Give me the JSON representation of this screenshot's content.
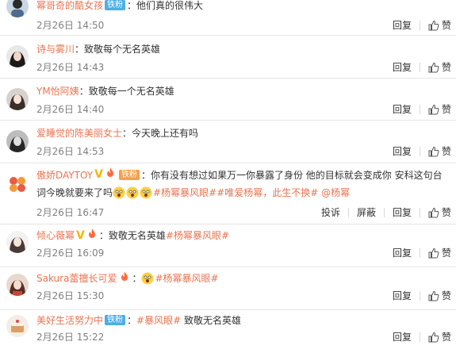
{
  "labels": {
    "reply": "回复",
    "like": "赞",
    "report": "投诉",
    "block": "屏蔽"
  },
  "colors": {
    "username": "#eb7350",
    "link": "#eb7350",
    "fan_badge": "#4aaee8",
    "verified": "#f7b500",
    "time": "#808080"
  },
  "comments": [
    {
      "username": "幂哥奇的酷女孩",
      "fan_badge": "铁粉",
      "content": "他们真的很伟大",
      "time": "2月26日 14:50",
      "avatar_icon": "avatar-boy-icon"
    },
    {
      "username": "诗与雾川",
      "content": "致敬每个无名英雄",
      "time": "2月26日 14:43",
      "avatar_icon": "avatar-girl-dark-icon"
    },
    {
      "username": "YM怡阿姨",
      "content": "致敬每一个无名英雄",
      "time": "2月26日 14:40",
      "avatar_icon": "avatar-girl-light-icon"
    },
    {
      "username": "爱睡觉的陈美丽女士",
      "content": "今天晚上还有吗",
      "time": "2月26日 14:53",
      "avatar_icon": "avatar-girl-bw-icon"
    },
    {
      "username": "傲娇DAYTOY",
      "fan_badge": "铁粉",
      "content_a": "你有没有想过如果万一你暴露了身份 他的目标就会变成你 安科这句台词今晚就要来了吗",
      "emoji_icons": [
        "fear-emoji",
        "fear-emoji",
        "fear-emoji"
      ],
      "tags": [
        "#杨幂暴风眼#",
        "#唯爱杨幂，此生不换#",
        "@杨幂"
      ],
      "time": "2月26日 16:47",
      "avatar_icon": "avatar-logo-icon"
    },
    {
      "username": "倾心薇幂",
      "content": "致敬无名英雄",
      "tags": [
        "#杨幂暴风眼#"
      ],
      "time": "2月26日 16:09",
      "avatar_icon": "avatar-girl-white-icon"
    },
    {
      "username": "Sakura蕾擅长可爱",
      "emoji_icons": [
        "fear-emoji"
      ],
      "tags": [
        "#杨幂暴风眼#"
      ],
      "time": "2月26日 15:30",
      "avatar_icon": "avatar-girl-red-icon"
    },
    {
      "username": "美好生活努力中",
      "fan_badge": "铁粉",
      "tags": [
        "#暴风眼#"
      ],
      "content": "致敬无名英雄",
      "time": "2月26日 15:22",
      "avatar_icon": "avatar-cake-icon"
    }
  ]
}
